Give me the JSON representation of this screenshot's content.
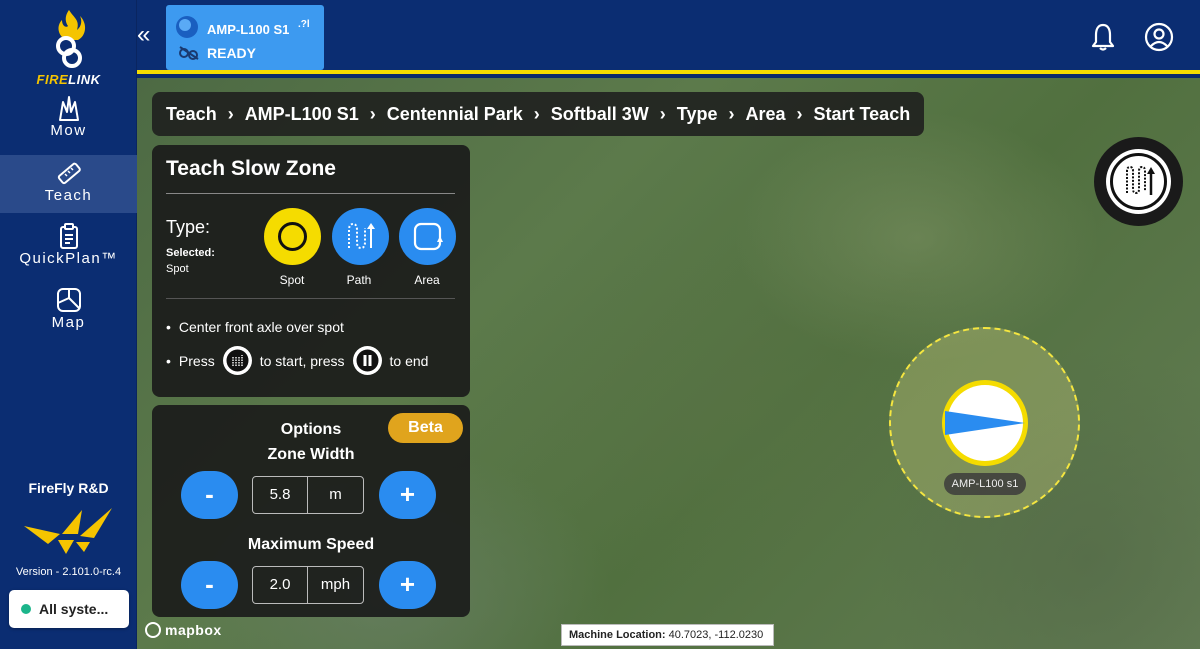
{
  "app": {
    "logo_text_fire": "FIRE",
    "logo_text_link": "LINK"
  },
  "sidebar": {
    "items": [
      {
        "label": "Mow",
        "icon": "grass-icon"
      },
      {
        "label": "Teach",
        "icon": "ruler-icon"
      },
      {
        "label": "QuickPlan™",
        "icon": "clipboard-icon"
      },
      {
        "label": "Map",
        "icon": "map-icon"
      }
    ],
    "active": "Teach",
    "org": "FireFly R&D",
    "version": "Version - 2.101.0-rc.4",
    "status": "All syste..."
  },
  "header": {
    "collapse_label": "«",
    "machine": {
      "name": "AMP-L100 S1",
      "signal": ".?l",
      "status": "READY"
    }
  },
  "breadcrumb": [
    "Teach",
    "AMP-L100 S1",
    "Centennial Park",
    "Softball 3W",
    "Type",
    "Area",
    "Start Teach"
  ],
  "teach_panel": {
    "title": "Teach Slow Zone",
    "type_label": "Type:",
    "selected_label": "Selected:",
    "selected_value": "Spot",
    "types": [
      {
        "label": "Spot",
        "icon": "spot-icon",
        "color": "#f5dc00"
      },
      {
        "label": "Path",
        "icon": "path-icon",
        "color": "#2a8cf0"
      },
      {
        "label": "Area",
        "icon": "area-icon",
        "color": "#2a8cf0"
      }
    ],
    "instruction_1": "Center front axle over spot",
    "instruction_2_a": "Press",
    "instruction_2_b": "to start, press",
    "instruction_2_c": "to end"
  },
  "options_panel": {
    "title": "Options",
    "badge": "Beta",
    "zone_width": {
      "label": "Zone Width",
      "value": "5.8",
      "unit": "m",
      "minus": "-",
      "plus": "+"
    },
    "max_speed": {
      "label": "Maximum Speed",
      "value": "2.0",
      "unit": "mph",
      "minus": "-",
      "plus": "+"
    }
  },
  "map": {
    "attribution": "mapbox",
    "machine_location_label": "Machine Location:",
    "machine_location_value": "40.7023, -112.0230",
    "machine_tag": "AMP-L100 s1"
  },
  "colors": {
    "accent_yellow": "#f5dc00",
    "nav_blue": "#0b2d72",
    "button_blue": "#2a8cf0",
    "beta_orange": "#e0a41d"
  }
}
